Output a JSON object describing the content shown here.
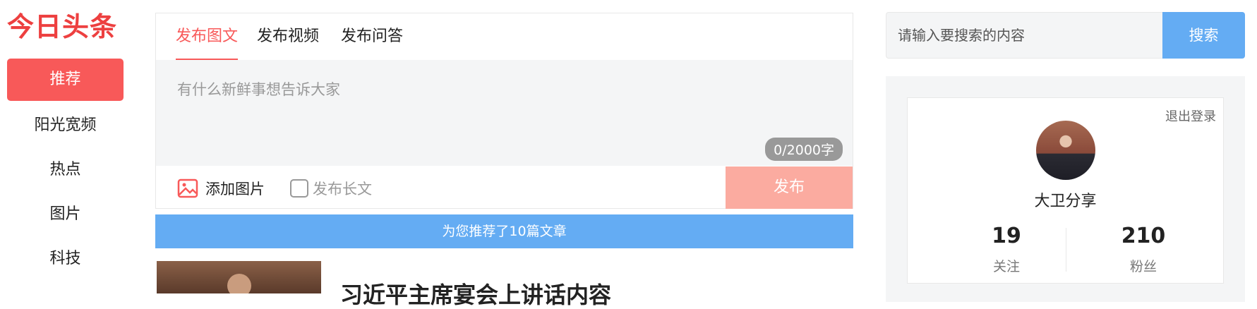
{
  "logo": "今日头条",
  "nav": {
    "items": [
      {
        "label": "推荐",
        "active": true
      },
      {
        "label": "阳光宽频"
      },
      {
        "label": "热点"
      },
      {
        "label": "图片"
      },
      {
        "label": "科技"
      }
    ]
  },
  "publisher": {
    "tabs": [
      "发布图文",
      "发布视频",
      "发布问答"
    ],
    "placeholder": "有什么新鲜事想告诉大家",
    "char_count": "0/2000字",
    "add_image": "添加图片",
    "long_post": "发布长文",
    "publish": "发布"
  },
  "recommend_bar": "为您推荐了10篇文章",
  "article": {
    "title": "习近平主席宴会上讲话内容"
  },
  "search": {
    "placeholder": "请输入要搜索的内容",
    "button": "搜索"
  },
  "user": {
    "logout": "退出登录",
    "name": "大卫分享",
    "following_count": "19",
    "following_label": "关注",
    "followers_count": "210",
    "followers_label": "粉丝"
  },
  "colors": {
    "accent": "#f85959",
    "blue": "#64acf3",
    "publish_disabled": "#fbaba0"
  }
}
